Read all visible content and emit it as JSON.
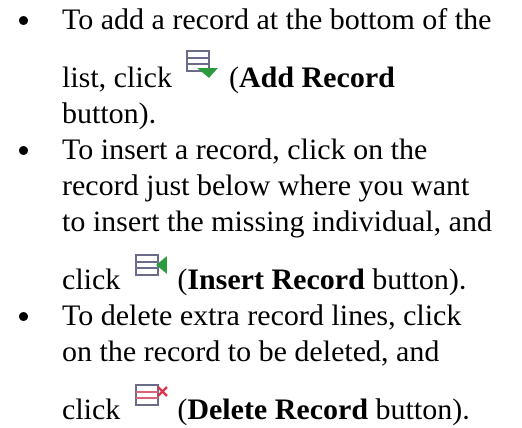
{
  "bullets": [
    {
      "line1": "To add a record at the bottom of the",
      "line2_pre": "list, click",
      "button_name": "Add Record",
      "line2_open": "(",
      "line3": "button).",
      "icon": "add-record-icon"
    },
    {
      "line1": "To insert a record, click on the",
      "line2": "record just below where you want",
      "line3": "to insert the missing individual, and",
      "line4_pre": "click",
      "line4_open": "(",
      "button_name": "Insert Record",
      "line4_post": " button).",
      "icon": "insert-record-icon"
    },
    {
      "line1": "To delete extra record lines, click",
      "line2": "on the record to be deleted, and",
      "line3_pre": "click",
      "line3_open": "(",
      "button_name": "Delete Record",
      "line3_post": " button).",
      "icon": "delete-record-icon"
    }
  ],
  "colors": {
    "record_lines": "#6b6b8a",
    "add_arrow": "#2e9a3e",
    "insert_arrow": "#2e9a3e",
    "delete_x": "#d8344a",
    "delete_lines": "#d86478"
  }
}
